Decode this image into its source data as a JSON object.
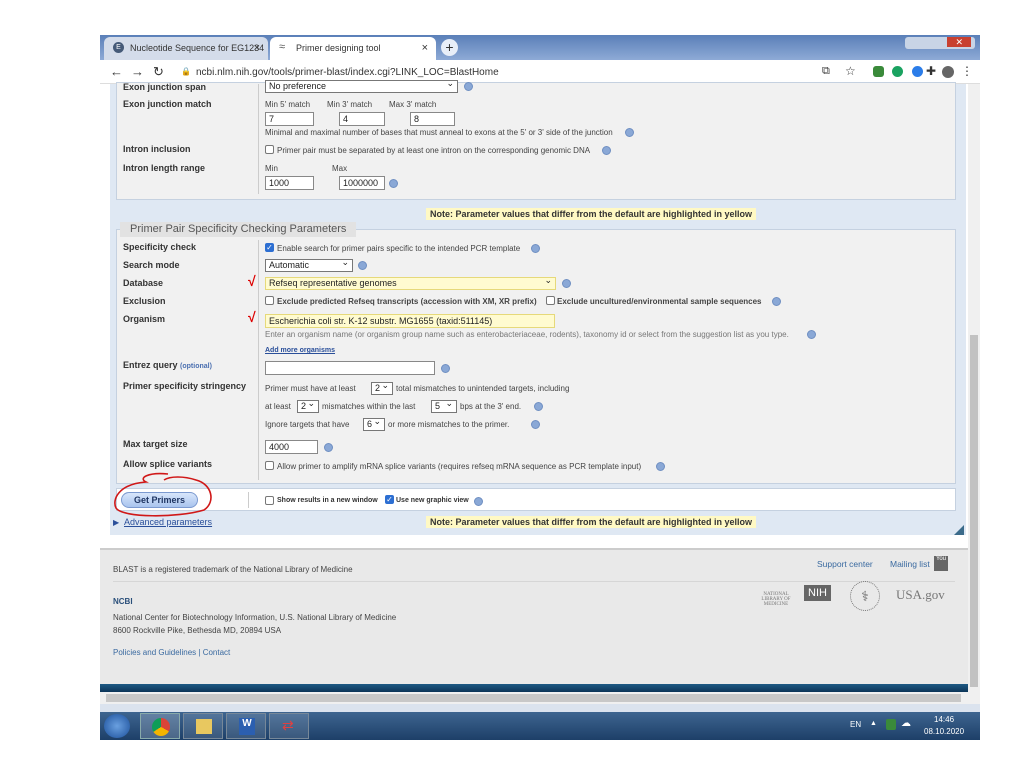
{
  "browser": {
    "tabs": [
      {
        "title": "Nucleotide Sequence for EG1234",
        "active": false
      },
      {
        "title": "Primer designing tool",
        "active": true
      }
    ],
    "url": "ncbi.nlm.nih.gov/tools/primer-blast/index.cgi?LINK_LOC=BlastHome"
  },
  "exon": {
    "span_label": "Exon junction span",
    "span_value": "No preference",
    "match_label": "Exon junction match",
    "min5_label": "Min 5' match",
    "min3_label": "Min 3' match",
    "max3_label": "Max 3' match",
    "min5": "7",
    "min3": "4",
    "max3": "8",
    "match_hint": "Minimal and maximal number of bases that must anneal to exons at the 5' or 3' side of the junction"
  },
  "intron": {
    "inclusion_label": "Intron inclusion",
    "inclusion_text": "Primer pair must be separated by at least one intron on the corresponding genomic DNA",
    "range_label": "Intron length range",
    "min_label": "Min",
    "max_label": "Max",
    "min": "1000",
    "max": "1000000"
  },
  "note": "Note: Parameter values that differ from the default are highlighted in yellow",
  "specificity": {
    "legend": "Primer Pair Specificity Checking Parameters",
    "check_label": "Specificity check",
    "check_text": "Enable search for primer pairs specific to the intended PCR template",
    "check_on": true,
    "mode_label": "Search mode",
    "mode_value": "Automatic",
    "db_label": "Database",
    "db_value": "Refseq representative genomes",
    "excl_label": "Exclusion",
    "excl1": "Exclude predicted Refseq transcripts (accession with XM, XR prefix)",
    "excl2": "Exclude uncultured/environmental sample sequences",
    "org_label": "Organism",
    "org_value": "Escherichia coli str. K-12 substr. MG1655 (taxid:511145)",
    "org_hint": "Enter an organism name (or organism group name such as enterobacteriaceae, rodents), taxonomy id or select from the suggestion list as you type.",
    "add_more": "Add more organisms",
    "entrez_label": "Entrez query",
    "entrez_optional": "(optional)",
    "entrez_value": "",
    "stringency_label": "Primer specificity stringency",
    "s1a": "Primer must have at least",
    "s1v": "2",
    "s1b": "total mismatches to unintended targets, including",
    "s2a": "at least",
    "s2v": "2",
    "s2b": "mismatches within the last",
    "s2v2": "5",
    "s2c": "bps at the 3' end.",
    "s3a": "Ignore targets that have",
    "s3v": "6",
    "s3b": "or more mismatches to the primer.",
    "max_label": "Max target size",
    "max_value": "4000",
    "splice_label": "Allow splice variants",
    "splice_text": "Allow primer to amplify mRNA splice variants (requires refseq mRNA sequence as PCR template input)"
  },
  "submit": {
    "button": "Get Primers",
    "new_window": "Show results in a new window",
    "graphic": "Use new graphic view",
    "advanced": "Advanced parameters"
  },
  "footer": {
    "trademark": "BLAST is a registered trademark of the National Library of Medicine",
    "support": "Support center",
    "mailing": "Mailing list",
    "ncbi": "NCBI",
    "org": "National Center for Biotechnology Information, U.S. National Library of Medicine",
    "address": "8600 Rockville Pike, Bethesda MD, 20894 USA",
    "policies": "Policies and Guidelines",
    "contact": "Contact",
    "nlm": "NATIONAL LIBRARY OF MEDICINE",
    "nih": "NIH",
    "usa": "USA.gov"
  },
  "taskbar": {
    "lang": "EN",
    "time": "14:46",
    "date": "08.10.2020"
  }
}
